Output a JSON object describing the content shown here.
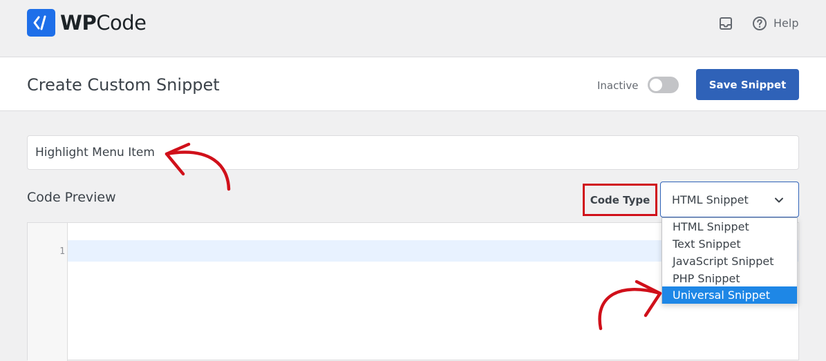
{
  "brand": {
    "logo_word_bold": "WP",
    "logo_word_regular": "Code",
    "logo_icon": "code-slash-icon",
    "accent": "#1e6fe9"
  },
  "topbar": {
    "inbox_icon": "inbox-icon",
    "help_icon": "question-circle-icon",
    "help_label": "Help"
  },
  "header": {
    "title": "Create Custom Snippet",
    "status_label": "Inactive",
    "save_label": "Save Snippet",
    "save_color": "#2f62b8"
  },
  "snippet": {
    "title_value": "Highlight Menu Item"
  },
  "code_preview": {
    "section_title": "Code Preview",
    "code_type_label": "Code Type",
    "selected_type": "HTML Snippet",
    "options": [
      "HTML Snippet",
      "Text Snippet",
      "JavaScript Snippet",
      "PHP Snippet",
      "Universal Snippet"
    ],
    "highlighted_option": "Universal Snippet",
    "line_numbers": [
      "1"
    ]
  },
  "annotations": {
    "arrow_color": "#d0101a",
    "highlight_box_color": "#d0101a"
  }
}
